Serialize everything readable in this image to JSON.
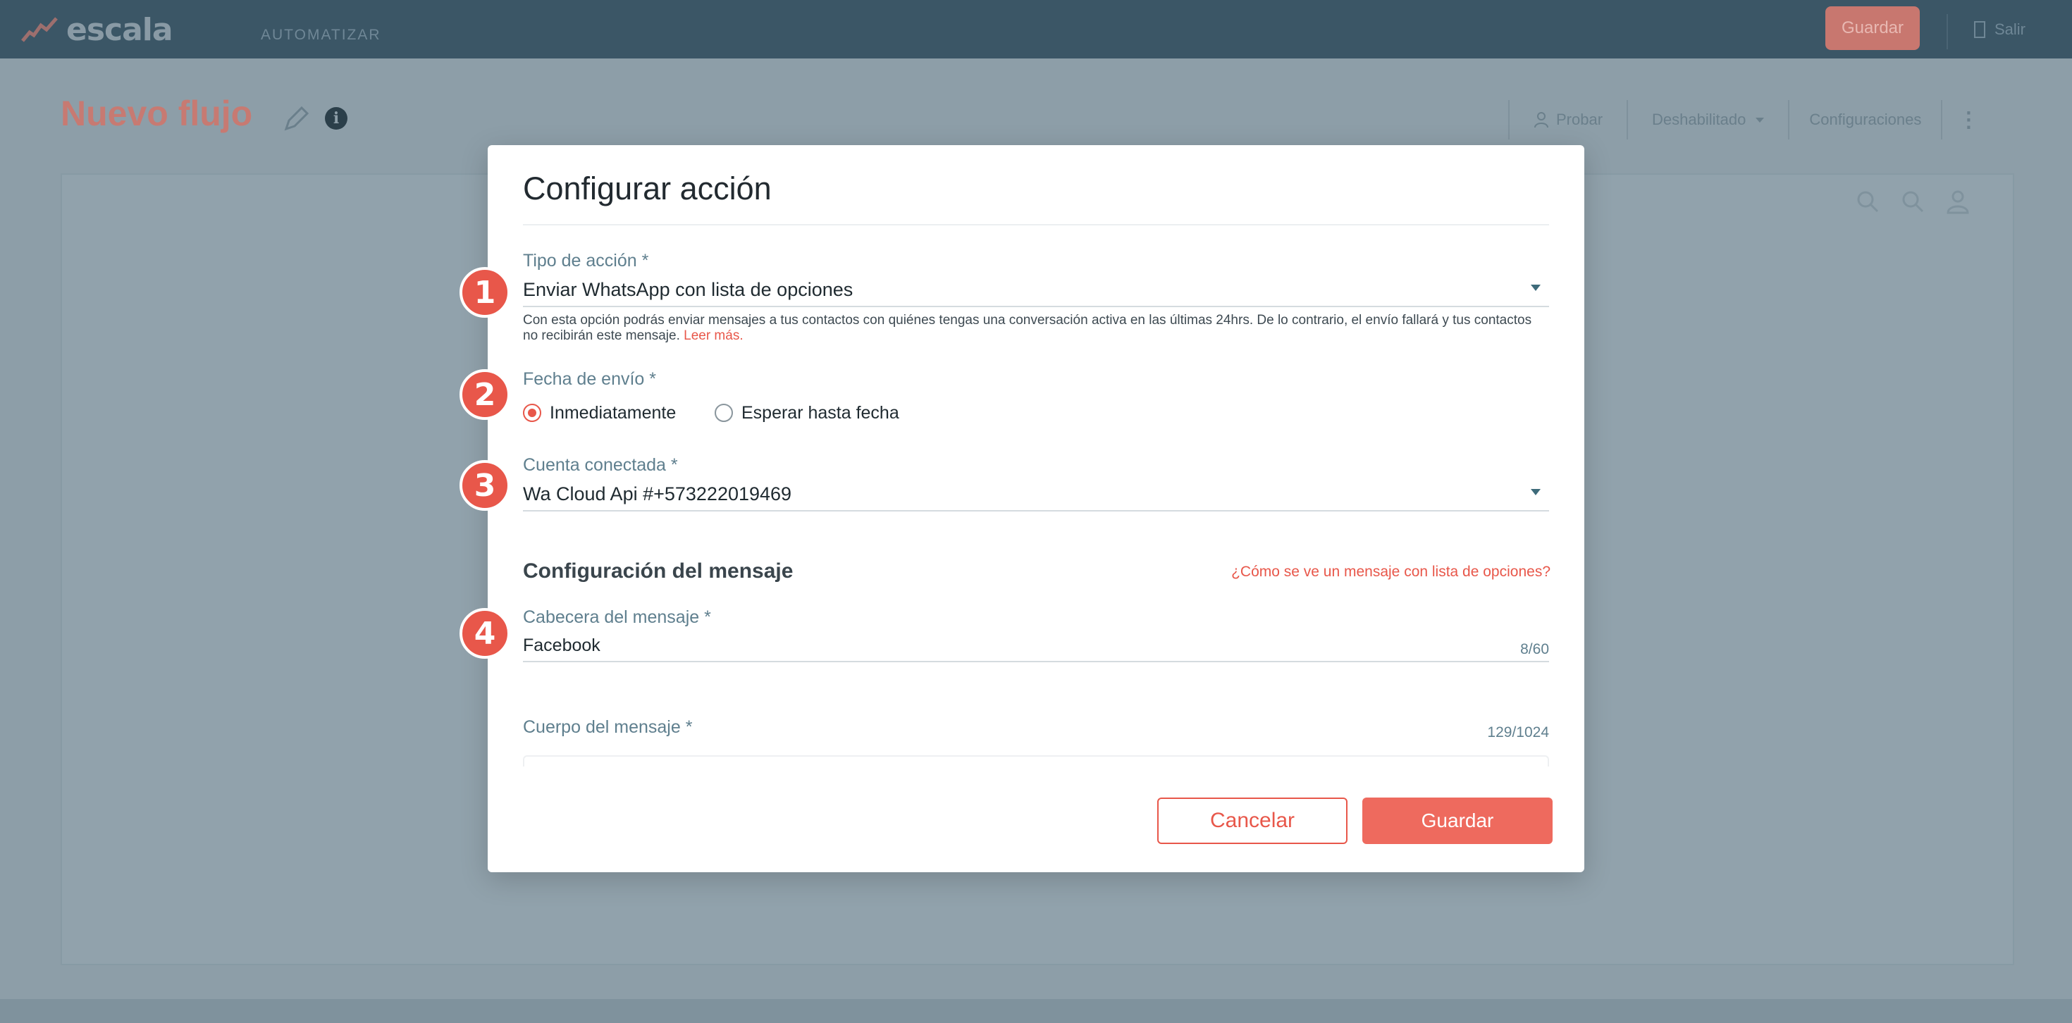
{
  "app": {
    "logo_text": "escala",
    "nav_item": "AUTOMATIZAR",
    "save_button": "Guardar",
    "exit_label": "Salir",
    "page_title": "Nuevo flujo",
    "toolbar": {
      "test_label": "Probar",
      "status_label": "Deshabilitado",
      "settings_label": "Configuraciones"
    }
  },
  "modal": {
    "title": "Configurar acción",
    "action_type": {
      "label": "Tipo de acción *",
      "value": "Enviar WhatsApp con lista de opciones",
      "help_text": "Con esta opción podrás enviar mensajes a tus contactos con quiénes tengas una conversación activa en las últimas 24hrs. De lo contrario, el envío fallará y tus contactos no recibirán este mensaje.",
      "help_link": "Leer más."
    },
    "send_date": {
      "label": "Fecha de envío *",
      "options": [
        "Inmediatamente",
        "Esperar hasta fecha"
      ],
      "selected": "Inmediatamente"
    },
    "account": {
      "label": "Cuenta conectada *",
      "value": "Wa Cloud Api #+573222019469"
    },
    "message_config": {
      "title": "Configuración del mensaje",
      "preview_link": "¿Cómo se ve un mensaje con lista de opciones?"
    },
    "header_field": {
      "label": "Cabecera del mensaje *",
      "value": "Facebook",
      "counter": "8/60"
    },
    "body_field": {
      "label": "Cuerpo del mensaje *",
      "counter": "129/1024"
    },
    "buttons": {
      "cancel": "Cancelar",
      "save": "Guardar"
    }
  },
  "badges": [
    "1",
    "2",
    "3",
    "4"
  ],
  "colors": {
    "accent": "#e8574a",
    "topbar": "#3b5666",
    "overlay": "#8d9ea8"
  }
}
